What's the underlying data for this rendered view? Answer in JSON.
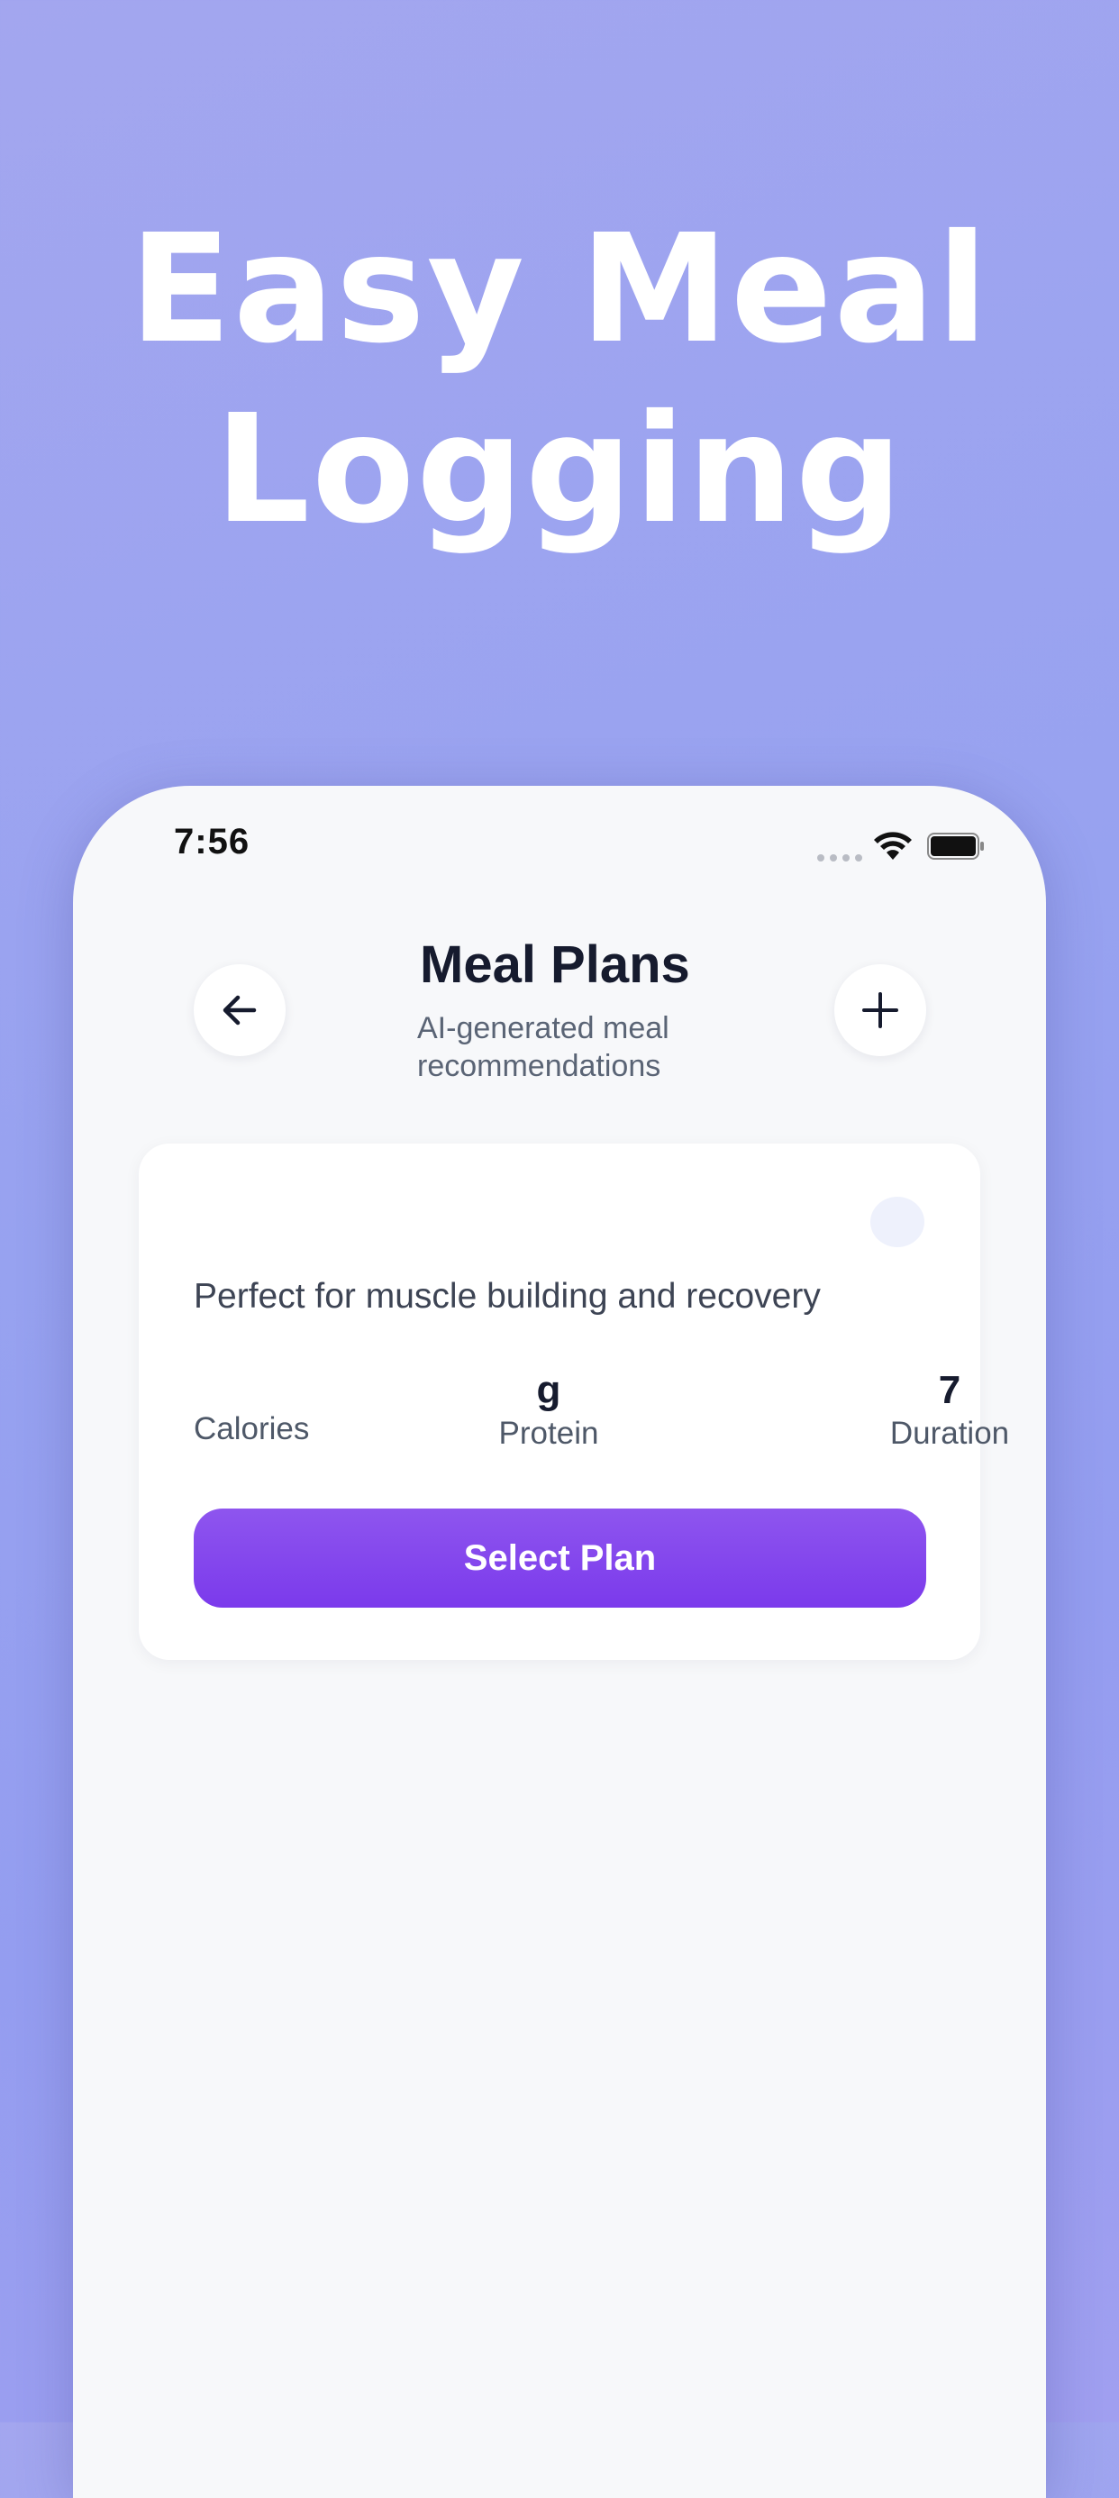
{
  "headline": {
    "line1": "Easy Meal",
    "line2": "Logging"
  },
  "status_bar": {
    "time": "7:56"
  },
  "header": {
    "title": "Meal Plans",
    "subtitle": "AI-generated meal recommendations",
    "back_icon": "arrow-left-icon",
    "add_icon": "plus-icon"
  },
  "plan_card": {
    "description": "Perfect for muscle building and recovery",
    "stats": {
      "calories": {
        "value": "",
        "label": "Calories"
      },
      "protein": {
        "value": "g",
        "label": "Protein"
      },
      "duration": {
        "value": "7",
        "label": "Duration"
      }
    },
    "button_label": "Select Plan"
  },
  "colors": {
    "background": "#9aa1f0",
    "accent": "#7f40ec",
    "card": "#ffffff",
    "screen": "#f7f8fa"
  }
}
